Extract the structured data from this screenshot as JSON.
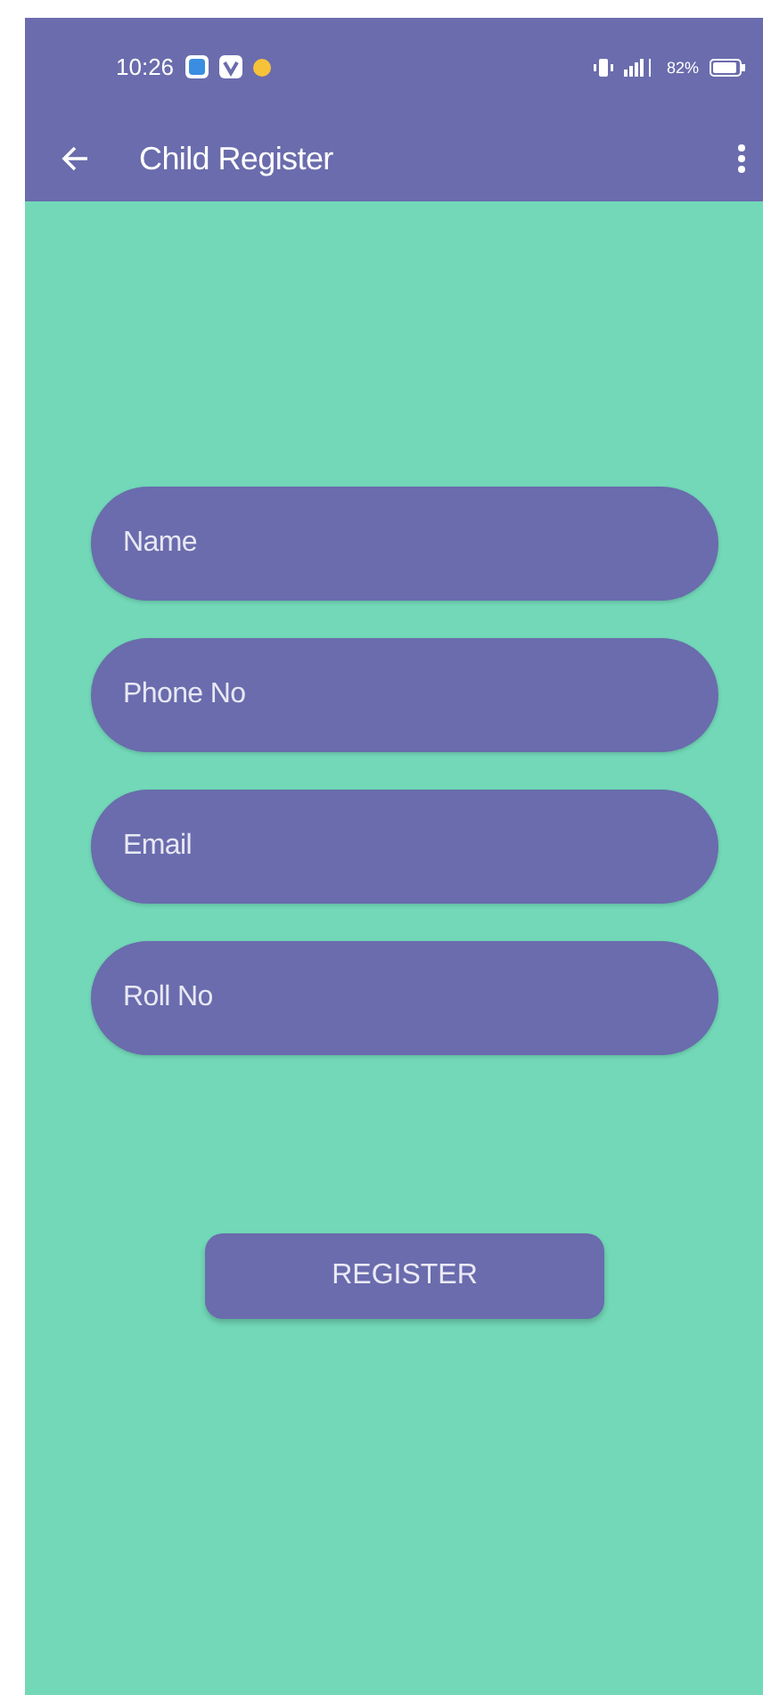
{
  "status_bar": {
    "time": "10:26",
    "battery_text": "82%"
  },
  "app_bar": {
    "title": "Child Register"
  },
  "fields": [
    {
      "placeholder": "Name"
    },
    {
      "placeholder": "Phone No"
    },
    {
      "placeholder": "Email"
    },
    {
      "placeholder": "Roll No"
    }
  ],
  "register_button": {
    "label": "REGISTER"
  }
}
